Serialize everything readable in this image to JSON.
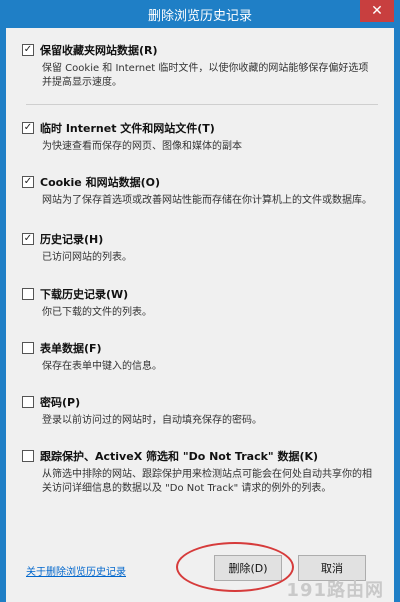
{
  "window": {
    "title": "删除浏览历史记录",
    "close_glyph": "✕"
  },
  "options": [
    {
      "checked": true,
      "label": "保留收藏夹网站数据(R)",
      "description": "保留 Cookie 和 Internet 临时文件，以使你收藏的网站能够保存偏好选项并提高显示速度。"
    },
    {
      "checked": true,
      "label": "临时 Internet 文件和网站文件(T)",
      "description": "为快速查看而保存的网页、图像和媒体的副本"
    },
    {
      "checked": true,
      "label": "Cookie 和网站数据(O)",
      "description": "网站为了保存首选项或改善网站性能而存储在你计算机上的文件或数据库。"
    },
    {
      "checked": true,
      "label": "历史记录(H)",
      "description": "已访问网站的列表。"
    },
    {
      "checked": false,
      "label": "下载历史记录(W)",
      "description": "你已下载的文件的列表。"
    },
    {
      "checked": false,
      "label": "表单数据(F)",
      "description": "保存在表单中键入的信息。"
    },
    {
      "checked": false,
      "label": "密码(P)",
      "description": "登录以前访问过的网站时，自动填充保存的密码。"
    },
    {
      "checked": false,
      "label": "跟踪保护、ActiveX 筛选和 \"Do Not Track\" 数据(K)",
      "description": "从筛选中排除的网站、跟踪保护用来检测站点可能会在何处自动共享你的相关访问详细信息的数据以及 \"Do Not Track\" 请求的例外的列表。"
    }
  ],
  "footer": {
    "about_link": "关于删除浏览历史记录",
    "delete_button": "删除(D)",
    "cancel_button": "取消"
  },
  "watermark": "191路由网",
  "colors": {
    "titlebar": "#1f7fc6",
    "close_button": "#c83f3f",
    "highlight_oval": "#d63b3b",
    "link": "#0066cc"
  }
}
